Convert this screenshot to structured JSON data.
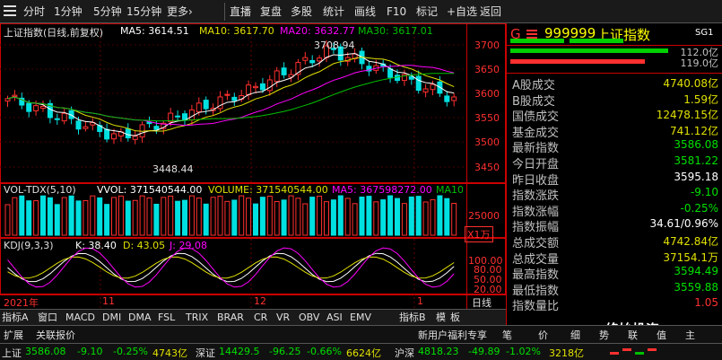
{
  "toolbar": {
    "items": [
      "分时",
      "1分钟",
      "5分钟",
      "15分钟",
      "更多"
    ],
    "more_arrow": "›",
    "right_items": [
      "直播",
      "复盘",
      "多股",
      "统计",
      "画线",
      "F10",
      "标记",
      "+自选",
      "返回"
    ]
  },
  "chart_header": {
    "title": "上证指数(日线,前复权)",
    "ma5": "MA5: 3614.51",
    "ma10": "MA10: 3617.70",
    "ma20": "MA20: 3632.77",
    "ma30": "MA30: 3617.01"
  },
  "price_axis": [
    "3700",
    "3650",
    "3600",
    "3550",
    "3500",
    "3450"
  ],
  "annotations": {
    "high": "3708.94",
    "low": "3448.44"
  },
  "volume_header": {
    "name": "VOL-TDX(5,10)",
    "vvol": "VVOL: 371540544.00",
    "volume": "VOLUME: 371540544.00",
    "ma5": "MA5: 367598272.00",
    "ma10": "MA10"
  },
  "volume_axis": {
    "v25000": "25000",
    "unit": "X1万"
  },
  "kdj_header": {
    "name": "KDJ(9,3,3)",
    "k": "K: 38.40",
    "d": "D: 43.05",
    "j": "J: 29.08"
  },
  "kdj_axis": [
    "100.00",
    "80.00",
    "50.00",
    "20.00"
  ],
  "date_axis": {
    "year": "2021年",
    "m11": "11",
    "m12": "12",
    "m1": "1",
    "period": "日线"
  },
  "tabs": [
    "指标A",
    "窗口",
    "MACD",
    "DMI",
    "DMA",
    "FSL",
    "TRIX",
    "BRAR",
    "CR",
    "VR",
    "OBV",
    "ASI",
    "EMV"
  ],
  "tab_more": "指标B",
  "tab_mode": "模",
  "tab_board": "板",
  "subtabs": [
    "扩展",
    "关联报价"
  ],
  "subtabs_right": [
    "新用户福利专享",
    "笔",
    "价",
    "细",
    "势",
    "联",
    "值",
    "主"
  ],
  "panel": {
    "code": "999999",
    "name": "上证指数",
    "badge": "SG1",
    "g_label": "G",
    "bar1_value": "112.0亿",
    "bar2_value": "119.0亿",
    "rows": [
      {
        "label": "A股成交",
        "value": "4740.08亿",
        "color": "#e0e000"
      },
      {
        "label": "B股成交",
        "value": "1.59亿",
        "color": "#e0e000"
      },
      {
        "label": "国债成交",
        "value": "12478.15亿",
        "color": "#e0e000"
      },
      {
        "label": "基金成交",
        "value": "741.12亿",
        "color": "#e0e000"
      },
      {
        "label": "最新指数",
        "value": "3586.08",
        "color": "#00e000"
      },
      {
        "label": "今日开盘",
        "value": "3581.22",
        "color": "#00e000"
      },
      {
        "label": "昨日收盘",
        "value": "3595.18",
        "color": "#ffffff"
      },
      {
        "label": "指数涨跌",
        "value": "-9.10",
        "color": "#00e000"
      },
      {
        "label": "指数涨幅",
        "value": "-0.25%",
        "color": "#00e000"
      },
      {
        "label": "指数振幅",
        "value": "34.61/0.96%",
        "color": "#ffffff"
      },
      {
        "label": "总成交额",
        "value": "4742.84亿",
        "color": "#e0e000"
      },
      {
        "label": "总成交量",
        "value": "37154.1万",
        "color": "#e0e000"
      },
      {
        "label": "最高指数",
        "value": "3594.49",
        "color": "#00e000"
      },
      {
        "label": "最低指数",
        "value": "3559.88",
        "color": "#00e000"
      },
      {
        "label": "指数量比",
        "value": "1.05",
        "color": "#ff3030"
      }
    ],
    "watermark": "终始投资"
  },
  "statusbar": {
    "sh_name": "上证",
    "sh_price": "3586.08",
    "sh_change": "-9.10",
    "sh_pct": "-0.25%",
    "sh_amount": "4743亿",
    "sz_name": "深证",
    "sz_price": "14429.5",
    "sz_change": "-96.25",
    "sz_pct": "-0.66%",
    "sz_amount": "6624亿",
    "hs_name": "沪深",
    "hs_price": "4818.23",
    "hs_change": "-49.89",
    "hs_pct": "-1.02%",
    "hs_amount": "3218亿"
  },
  "colors": {
    "up": "#ff3030",
    "down": "#00e0e0",
    "ma5": "#ffffff",
    "ma10": "#e0e000",
    "ma20": "#ff00ff",
    "ma30": "#00c000"
  }
}
